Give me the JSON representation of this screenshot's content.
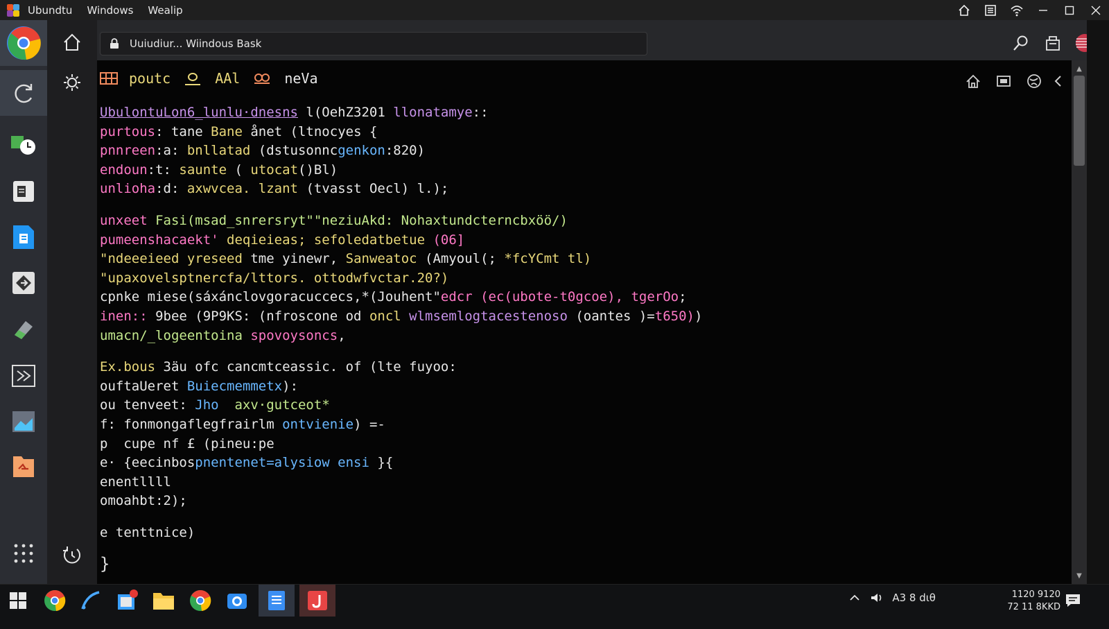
{
  "titlebar": {
    "menu": [
      "Ubundtu",
      "Windows",
      "Wealip"
    ]
  },
  "address": {
    "text": "Uuiudiur... Wiindous Bask"
  },
  "toolbar": {
    "items": [
      {
        "text": "poutc",
        "color": "#e9d87a"
      },
      {
        "text": "AAl",
        "color": "#e9d87a"
      },
      {
        "text": "neVa",
        "color": "#e8e8e8"
      }
    ]
  },
  "code": {
    "block1": [
      [
        {
          "t": "UbulontuLon6_lunlu·dnesns",
          "c": "#c792ea",
          "u": true
        },
        {
          "t": " l(OehZ3201 ",
          "c": "#e8e8e8"
        },
        {
          "t": "llonatamye",
          "c": "#c792ea"
        },
        {
          "t": "::",
          "c": "#e8e8e8"
        }
      ],
      [
        {
          "t": "purtous",
          "c": "#ff79c6"
        },
        {
          "t": ": tane ",
          "c": "#e8e8e8"
        },
        {
          "t": "Bane ",
          "c": "#e9d87a"
        },
        {
          "t": "ånet (ltnocyes {",
          "c": "#e8e8e8"
        }
      ],
      [
        {
          "t": "pnnreen",
          "c": "#ff79c6"
        },
        {
          "t": ":a: ",
          "c": "#e8e8e8"
        },
        {
          "t": "bnllatad ",
          "c": "#e9d87a"
        },
        {
          "t": "(dstusonnc",
          "c": "#e8e8e8"
        },
        {
          "t": "genkon",
          "c": "#69b7ff"
        },
        {
          "t": ":820)",
          "c": "#e8e8e8"
        }
      ],
      [
        {
          "t": "endoun",
          "c": "#ff79c6"
        },
        {
          "t": ":t: ",
          "c": "#e8e8e8"
        },
        {
          "t": "saunte ",
          "c": "#e9d87a"
        },
        {
          "t": "( ",
          "c": "#e8e8e8"
        },
        {
          "t": "utocat",
          "c": "#e9d87a"
        },
        {
          "t": "()Bl)",
          "c": "#e8e8e8"
        }
      ],
      [
        {
          "t": "unlioha",
          "c": "#ff79c6"
        },
        {
          "t": ":d: ",
          "c": "#e8e8e8"
        },
        {
          "t": "axwvcea. lzant ",
          "c": "#e9d87a"
        },
        {
          "t": "(tvasst Oecl) l.);",
          "c": "#e8e8e8"
        }
      ]
    ],
    "block2": [
      [
        {
          "t": "unxeet ",
          "c": "#ff79c6"
        },
        {
          "t": "Fasi(msad_snrersryt\"\"neziuAkd: Nohaxtundcterncbxöö/)",
          "c": "#c3e88d"
        }
      ],
      [
        {
          "t": "pumeenshacaekt' ",
          "c": "#ff79c6"
        },
        {
          "t": "deqieieas; sefoledatbetue ",
          "c": "#e9d87a"
        },
        {
          "t": "(06]",
          "c": "#ff79c6"
        }
      ],
      [
        {
          "t": "\"ndeeeieed yreseed ",
          "c": "#e9d87a"
        },
        {
          "t": "tme yinewr, ",
          "c": "#e8e8e8"
        },
        {
          "t": "Sanweatoc ",
          "c": "#e9d87a"
        },
        {
          "t": "(Amyoul(; ",
          "c": "#e8e8e8"
        },
        {
          "t": "*fcYCmt tl)",
          "c": "#e9d87a"
        }
      ],
      [
        {
          "t": "\"upaxovelsptnercfa/lttors. ",
          "c": "#e9d87a"
        },
        {
          "t": "ottodwfvctar.20?)",
          "c": "#e9d87a"
        }
      ],
      [
        {
          "t": "cpnke miese(",
          "c": "#e8e8e8"
        },
        {
          "t": "sáxánclovgoracuccecs",
          "c": "#e8e8e8"
        },
        {
          "t": ",*(Jouhent\"",
          "c": "#e8e8e8"
        },
        {
          "t": "edcr (ec(ubote-t0gcoe), ",
          "c": "#ff79c6"
        },
        {
          "t": "tgerOo",
          "c": "#ff79c6"
        },
        {
          "t": ";",
          "c": "#e8e8e8"
        }
      ],
      [
        {
          "t": "inen:: ",
          "c": "#ff79c6"
        },
        {
          "t": "9bee (9P9KS: (nfroscone od ",
          "c": "#e8e8e8"
        },
        {
          "t": "oncl ",
          "c": "#e9d87a"
        },
        {
          "t": "wlmsemlogtacestenoso ",
          "c": "#c792ea"
        },
        {
          "t": "(oantes )=",
          "c": "#e8e8e8"
        },
        {
          "t": "t650)",
          "c": "#ff79c6"
        },
        {
          "t": ")",
          "c": "#e8e8e8"
        }
      ],
      [
        {
          "t": "umacn/_logeentoina ",
          "c": "#c3e88d"
        },
        {
          "t": "spovoysoncs",
          "c": "#ff79c6"
        },
        {
          "t": ",",
          "c": "#e8e8e8"
        }
      ]
    ],
    "block3": [
      [
        {
          "t": "Ex.bous ",
          "c": "#e9d87a"
        },
        {
          "t": "3äu ofc cancmtceassic. of (lte fuyoo:",
          "c": "#e8e8e8"
        }
      ],
      [
        {
          "t": "ouftaUeret ",
          "c": "#e8e8e8"
        },
        {
          "t": "Buiecmemmetx",
          "c": "#69b7ff"
        },
        {
          "t": "):",
          "c": "#e8e8e8"
        }
      ],
      [
        {
          "t": "ou tenveet: ",
          "c": "#e8e8e8"
        },
        {
          "t": "Jho  ",
          "c": "#69b7ff"
        },
        {
          "t": "axv·gutceot*",
          "c": "#c3e88d"
        }
      ],
      [
        {
          "t": "f: fonmongaflegfrairlm ",
          "c": "#e8e8e8"
        },
        {
          "t": "ontvienie",
          "c": "#69b7ff"
        },
        {
          "t": ") =-",
          "c": "#e8e8e8"
        }
      ],
      [
        {
          "t": "p  cupe nf £ (",
          "c": "#e8e8e8"
        },
        {
          "t": "pineu:pe",
          "c": "#e8e8e8"
        }
      ],
      [
        {
          "t": "e· {eecinbos",
          "c": "#e8e8e8"
        },
        {
          "t": "pnentenet=alysiow ensi",
          "c": "#69b7ff"
        },
        {
          "t": " }{",
          "c": "#e8e8e8"
        }
      ],
      [
        {
          "t": "enentllll",
          "c": "#e8e8e8"
        }
      ],
      [
        {
          "t": "omoahbt:2);",
          "c": "#e8e8e8"
        }
      ]
    ],
    "block4": [
      [
        {
          "t": "e tenttnice)",
          "c": "#e8e8e8"
        }
      ]
    ],
    "closing": "}"
  },
  "clock": {
    "line1": "1120 9120",
    "line2": "72 11 8KKD"
  },
  "tray": {
    "text": "A3 8 dιθ"
  },
  "colors": {
    "titlebar": "#1f1f1f",
    "leftbar": "#2b2d33",
    "terminal_bg": "#050505",
    "taskbar": "#111214"
  }
}
